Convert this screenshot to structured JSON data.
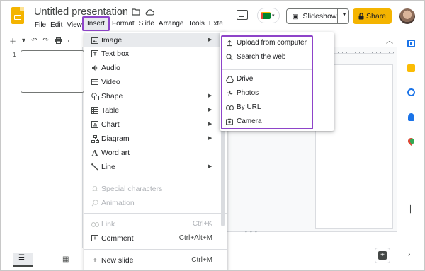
{
  "header": {
    "title": "Untitled presentation",
    "menus": [
      "File",
      "Edit",
      "View"
    ],
    "insert_menu_label": "Insert",
    "menus_after": [
      "Format",
      "Slide",
      "Arrange",
      "Tools",
      "Exten"
    ],
    "slideshow_label": "Slideshow",
    "share_label": "Share"
  },
  "filmstrip": {
    "slide_number": "1"
  },
  "insert_menu": {
    "items": [
      {
        "label": "Image",
        "icon": "image-icon",
        "submenu": true
      },
      {
        "label": "Text box",
        "icon": "text-box-icon"
      },
      {
        "label": "Audio",
        "icon": "audio-icon"
      },
      {
        "label": "Video",
        "icon": "video-icon"
      },
      {
        "label": "Shape",
        "icon": "shape-icon",
        "submenu": true
      },
      {
        "label": "Table",
        "icon": "table-icon",
        "submenu": true
      },
      {
        "label": "Chart",
        "icon": "chart-icon",
        "submenu": true
      },
      {
        "label": "Diagram",
        "icon": "diagram-icon",
        "submenu": true
      },
      {
        "label": "Word art",
        "icon": "word-art-icon"
      },
      {
        "label": "Line",
        "icon": "line-icon",
        "submenu": true
      },
      {
        "label": "Special characters",
        "icon": "omega-icon",
        "disabled": true
      },
      {
        "label": "Animation",
        "icon": "animation-icon",
        "disabled": true
      },
      {
        "label": "Link",
        "icon": "link-icon",
        "shortcut": "Ctrl+K",
        "disabled": true
      },
      {
        "label": "Comment",
        "icon": "add-comment-icon",
        "shortcut": "Ctrl+Alt+M"
      },
      {
        "label": "New slide",
        "icon": "plus-icon",
        "shortcut": "Ctrl+M"
      }
    ]
  },
  "image_submenu": {
    "items": [
      {
        "label": "Upload from computer",
        "icon": "upload-icon"
      },
      {
        "label": "Search the web",
        "icon": "search-icon"
      },
      {
        "label": "Drive",
        "icon": "drive-icon"
      },
      {
        "label": "Photos",
        "icon": "photos-icon"
      },
      {
        "label": "By URL",
        "icon": "link-icon"
      },
      {
        "label": "Camera",
        "icon": "camera-icon"
      }
    ]
  },
  "colors": {
    "highlight_border": "#8e44c9",
    "share_button": "#f4b400",
    "menu_hover": "#e8eaed"
  }
}
